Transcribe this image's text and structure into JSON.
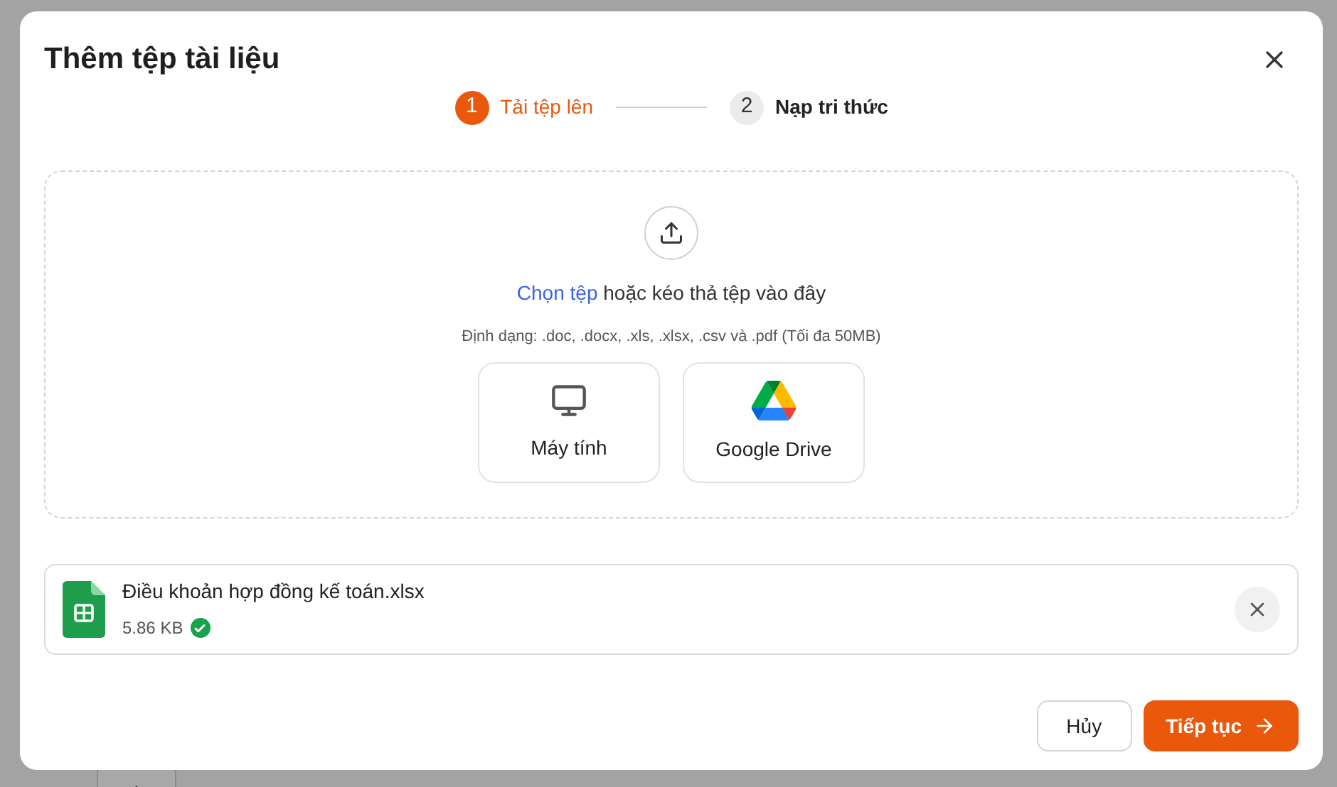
{
  "dialog": {
    "title": "Thêm tệp tài liệu",
    "steps": [
      {
        "number": "1",
        "label": "Tải tệp lên",
        "selected": true
      },
      {
        "number": "2",
        "label": "Nạp tri thức",
        "selected": false
      }
    ],
    "dropzone": {
      "link": "Chọn tệp",
      "text": "hoặc kéo thả tệp vào đây",
      "formats": "Định dạng: .doc, .docx, .xls, .xlsx, .csv và .pdf (Tối đa 50MB)",
      "sources": [
        {
          "kind": "computer",
          "label": "Máy tính"
        },
        {
          "kind": "drive",
          "label": "Google Drive"
        }
      ]
    },
    "files": [
      {
        "name": "Điều khoản hợp đồng kế toán.xlsx",
        "size": "5.86 KB",
        "uploaded": true
      }
    ],
    "buttons": {
      "cancel": "Hủy",
      "next": "Tiếp tục"
    }
  }
}
